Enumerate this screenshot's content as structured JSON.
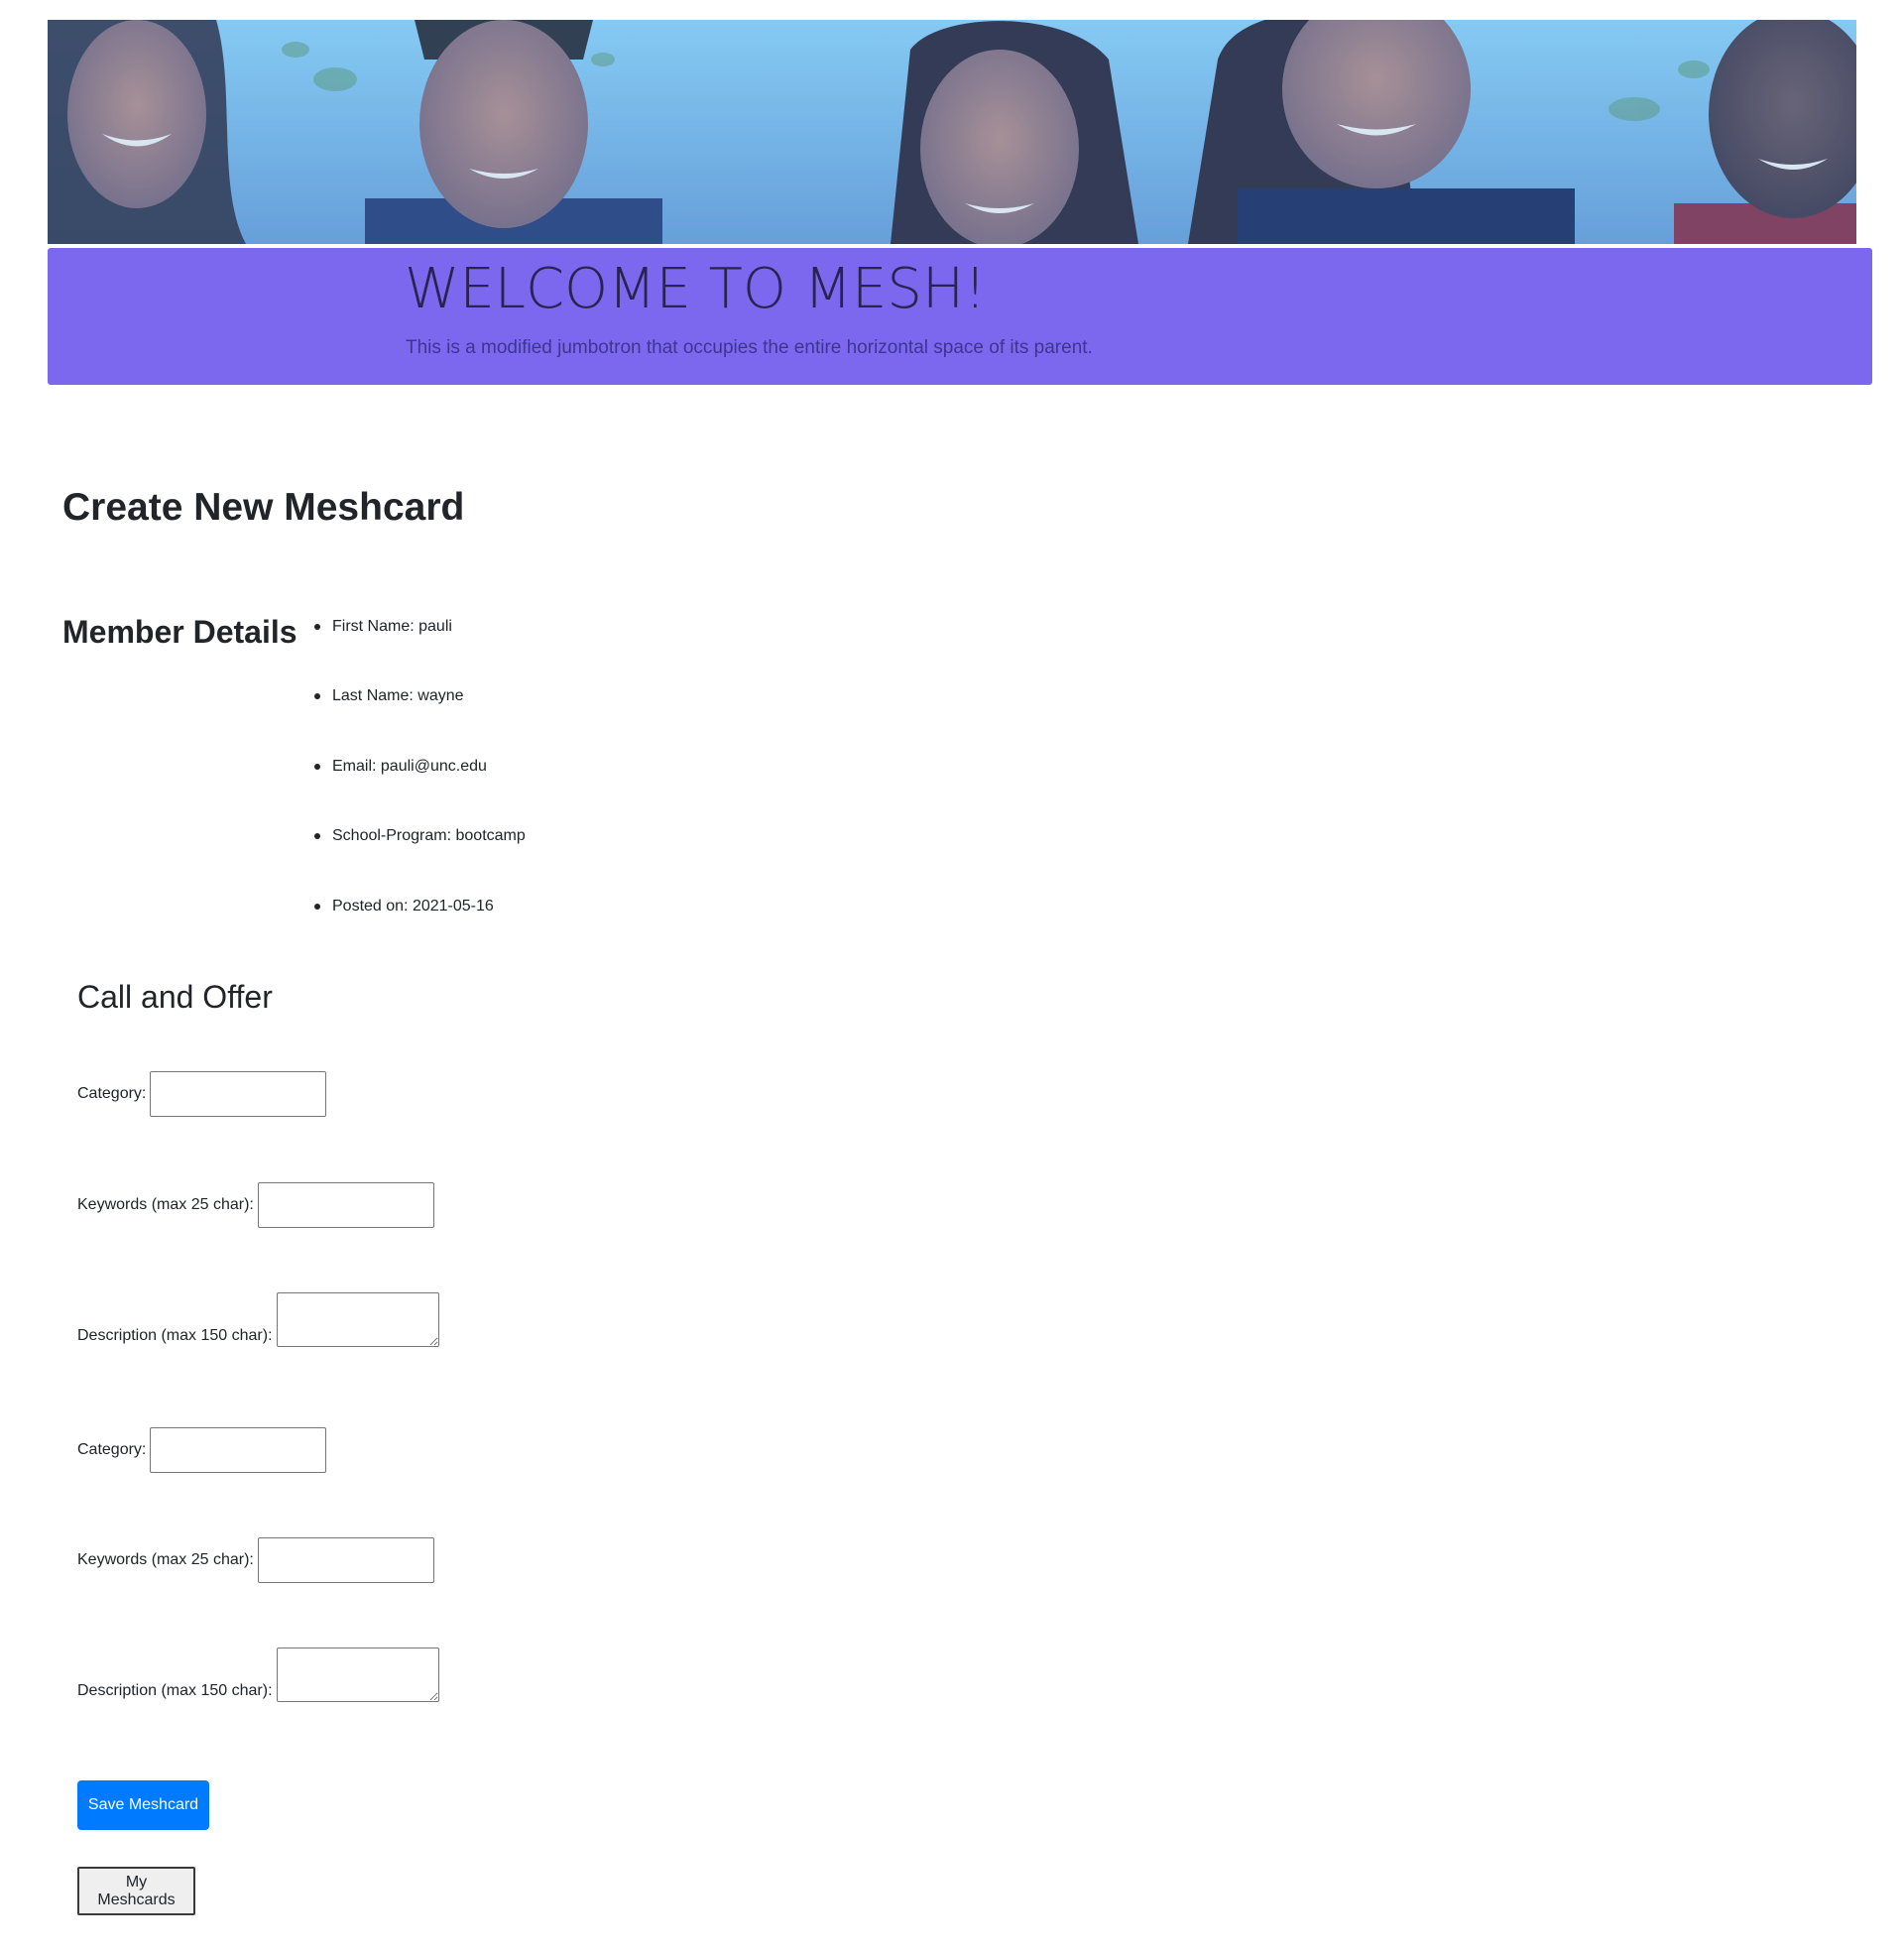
{
  "banner": {
    "image_description": "students-banner-image"
  },
  "jumbotron": {
    "title": "WELCOME TO MESH!",
    "lead": "This is a modified jumbotron that occupies the entire horizontal space of its parent.",
    "background_color": "#7b68ee"
  },
  "page": {
    "title": "Create New Meshcard"
  },
  "member": {
    "heading": "Member Details",
    "items": [
      "First Name: pauli",
      "Last Name: wayne",
      "Email: pauli@unc.edu",
      "School-Program: bootcamp",
      "Posted on: 2021-05-16"
    ]
  },
  "offer": {
    "heading": "Call and Offer",
    "call": {
      "category_label": "Category:",
      "category_value": "",
      "keywords_label": "Keywords (max 25 char):",
      "keywords_value": "",
      "description_label": "Description (max 150 char):",
      "description_value": ""
    },
    "offer": {
      "category_label": "Category:",
      "category_value": "",
      "keywords_label": "Keywords (max 25 char):",
      "keywords_value": "",
      "description_label": "Description (max 150 char):",
      "description_value": ""
    }
  },
  "actions": {
    "save_label": "Save Meshcard",
    "my_meshcards_label": "My Meshcards",
    "primary_color": "#007bff"
  }
}
